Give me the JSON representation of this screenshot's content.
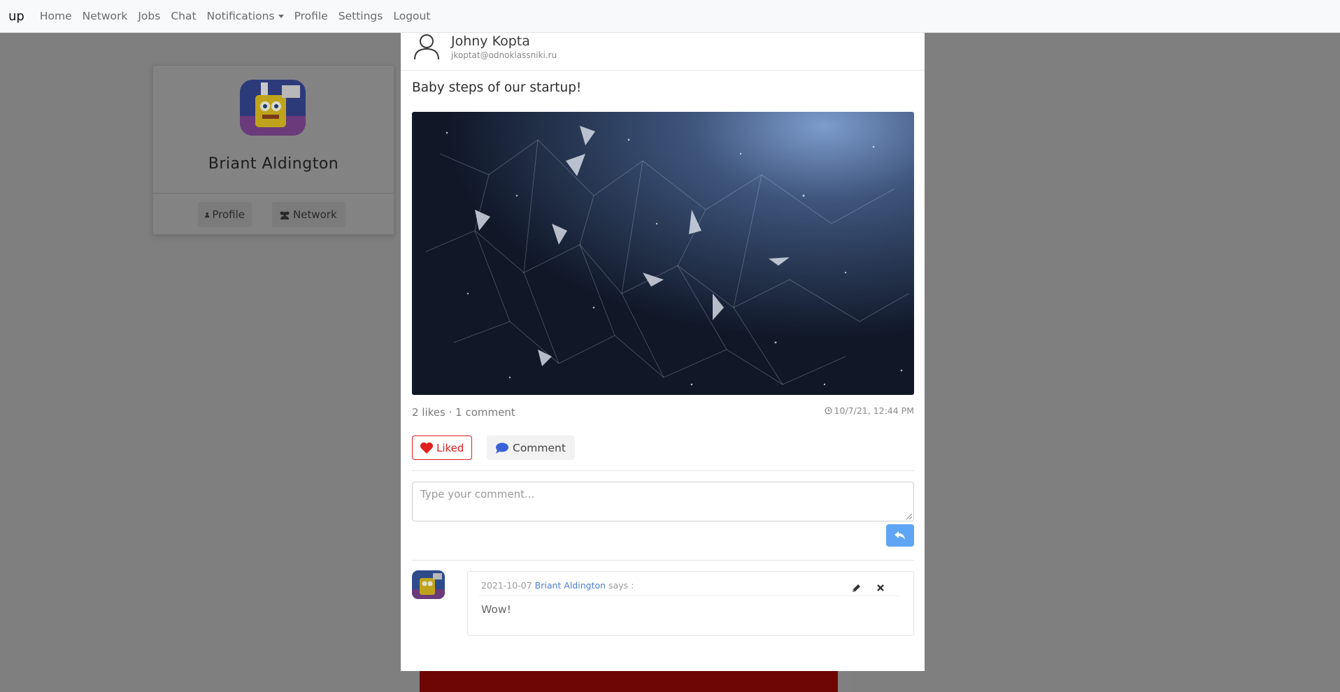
{
  "navbar": {
    "brand": "up",
    "links": [
      "Home",
      "Network",
      "Jobs",
      "Chat",
      "Notifications",
      "Profile",
      "Settings",
      "Logout"
    ]
  },
  "profile_card": {
    "name": "Briant Aldington",
    "buttons": [
      "Profile",
      "Network"
    ]
  },
  "post": {
    "author_name": "Johny Kopta",
    "author_email": "jkoptat@odnoklassniki.ru",
    "text": "Baby steps of our startup!",
    "stats": "2 likes · 1 comment",
    "timestamp": "10/7/21, 12:44 PM",
    "like_label": "Liked",
    "comment_label": "Comment",
    "comment_placeholder": "Type your comment..."
  },
  "comments": [
    {
      "date": "2021-10-07",
      "user": "Briant Aldington",
      "says": "says :",
      "text": "Wow!"
    }
  ],
  "colors": {
    "liked": "#e02020",
    "comment_icon": "#3a63d8",
    "send_button": "#5fa5f5",
    "backdrop": "#7f7f7f"
  }
}
